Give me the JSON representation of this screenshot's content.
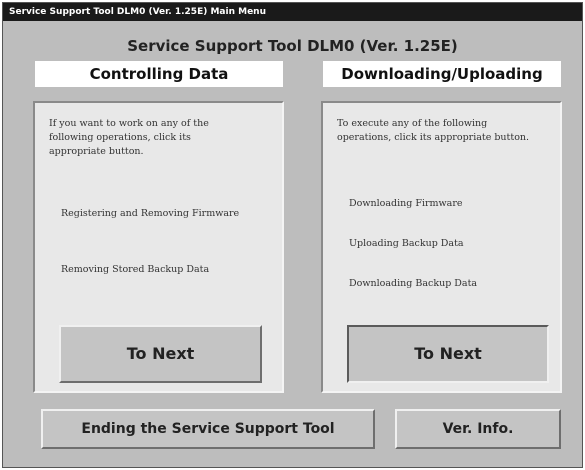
{
  "window": {
    "title": "Service Support Tool DLM0 (Ver. 1.25E)  Main Menu",
    "main_title": "Service Support Tool DLM0 (Ver. 1.25E)"
  },
  "left_panel": {
    "header": "Controlling Data",
    "intro": "If you want to work on any of the following operations, click its appropriate button.",
    "operations": [
      "Registering and Removing Firmware",
      "Removing Stored Backup Data"
    ],
    "next_label": "To Next"
  },
  "right_panel": {
    "header": "Downloading/Uploading",
    "intro": "To execute any of the following operations, click its appropriate button.",
    "operations": [
      "Downloading Firmware",
      "Uploading Backup Data",
      "Downloading Backup Data"
    ],
    "next_label": "To Next"
  },
  "footer": {
    "ending_label": "Ending the Service Support Tool",
    "ver_info_label": "Ver. Info."
  }
}
